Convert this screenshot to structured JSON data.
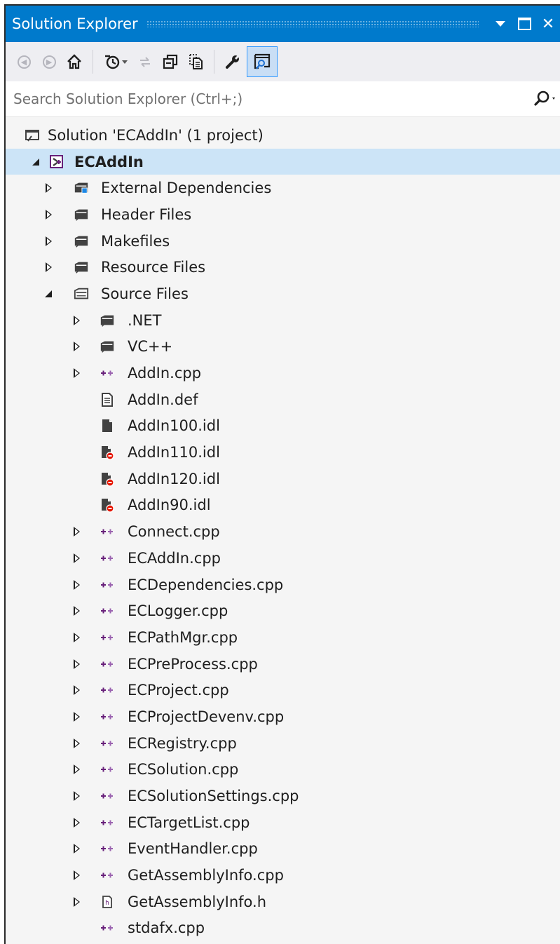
{
  "window": {
    "title": "Solution Explorer",
    "menu_arrow_icon": "dropdown-triangle",
    "maximize_icon": "maximize-square",
    "close_glyph": "✕"
  },
  "toolbar": {
    "buttons": [
      {
        "name": "back-button",
        "icon": "back-arrow-icon"
      },
      {
        "name": "forward-button",
        "icon": "forward-arrow-icon"
      },
      {
        "name": "home-button",
        "icon": "home-icon"
      },
      {
        "name": "pending-changes-button",
        "icon": "clock-history-icon"
      },
      {
        "name": "sync-button",
        "icon": "sync-arrows-icon"
      },
      {
        "name": "collapse-all-button",
        "icon": "collapse-all-icon"
      },
      {
        "name": "show-all-files-button",
        "icon": "show-all-files-icon"
      },
      {
        "name": "properties-button",
        "icon": "wrench-icon"
      },
      {
        "name": "preview-button",
        "icon": "preview-selected-icon"
      }
    ],
    "active_accent": "#3399ff"
  },
  "search": {
    "placeholder": "Search Solution Explorer (Ctrl+;)",
    "icon": "search-icon"
  },
  "colors": {
    "titlebar": "#007acc",
    "selection": "#cce4f7",
    "cpp_icon": "#68217a",
    "excluded_badge": "#e51400",
    "folder": "#424242"
  },
  "tree": [
    {
      "label": "Solution 'ECAddIn' (1 project)",
      "level": 0,
      "expander": "none",
      "icon": "solution-icon"
    },
    {
      "label": "ECAddIn",
      "level": 0,
      "expander": "expanded",
      "icon": "project-icon",
      "selected": true,
      "bold": true
    },
    {
      "label": "External Dependencies",
      "level": 1,
      "expander": "collapsed",
      "icon": "external-deps-folder-icon"
    },
    {
      "label": "Header Files",
      "level": 1,
      "expander": "collapsed",
      "icon": "filter-folder-icon"
    },
    {
      "label": "Makefiles",
      "level": 1,
      "expander": "collapsed",
      "icon": "filter-folder-icon"
    },
    {
      "label": "Resource Files",
      "level": 1,
      "expander": "collapsed",
      "icon": "filter-folder-icon"
    },
    {
      "label": "Source Files",
      "level": 1,
      "expander": "expanded",
      "icon": "filter-folder-open-icon"
    },
    {
      "label": ".NET",
      "level": 2,
      "expander": "collapsed",
      "icon": "filter-folder-icon"
    },
    {
      "label": "VC++",
      "level": 2,
      "expander": "collapsed",
      "icon": "filter-folder-icon"
    },
    {
      "label": "AddIn.cpp",
      "level": 2,
      "expander": "collapsed",
      "icon": "cpp-file-icon"
    },
    {
      "label": "AddIn.def",
      "level": 2,
      "expander": "none",
      "icon": "text-file-icon"
    },
    {
      "label": "AddIn100.idl",
      "level": 2,
      "expander": "none",
      "icon": "idl-file-icon"
    },
    {
      "label": "AddIn110.idl",
      "level": 2,
      "expander": "none",
      "icon": "idl-file-excluded-icon"
    },
    {
      "label": "AddIn120.idl",
      "level": 2,
      "expander": "none",
      "icon": "idl-file-excluded-icon"
    },
    {
      "label": "AddIn90.idl",
      "level": 2,
      "expander": "none",
      "icon": "idl-file-excluded-icon"
    },
    {
      "label": "Connect.cpp",
      "level": 2,
      "expander": "collapsed",
      "icon": "cpp-file-icon"
    },
    {
      "label": "ECAddIn.cpp",
      "level": 2,
      "expander": "collapsed",
      "icon": "cpp-file-icon"
    },
    {
      "label": "ECDependencies.cpp",
      "level": 2,
      "expander": "collapsed",
      "icon": "cpp-file-icon"
    },
    {
      "label": "ECLogger.cpp",
      "level": 2,
      "expander": "collapsed",
      "icon": "cpp-file-icon"
    },
    {
      "label": "ECPathMgr.cpp",
      "level": 2,
      "expander": "collapsed",
      "icon": "cpp-file-icon"
    },
    {
      "label": "ECPreProcess.cpp",
      "level": 2,
      "expander": "collapsed",
      "icon": "cpp-file-icon"
    },
    {
      "label": "ECProject.cpp",
      "level": 2,
      "expander": "collapsed",
      "icon": "cpp-file-icon"
    },
    {
      "label": "ECProjectDevenv.cpp",
      "level": 2,
      "expander": "collapsed",
      "icon": "cpp-file-icon"
    },
    {
      "label": "ECRegistry.cpp",
      "level": 2,
      "expander": "collapsed",
      "icon": "cpp-file-icon"
    },
    {
      "label": "ECSolution.cpp",
      "level": 2,
      "expander": "collapsed",
      "icon": "cpp-file-icon"
    },
    {
      "label": "ECSolutionSettings.cpp",
      "level": 2,
      "expander": "collapsed",
      "icon": "cpp-file-icon"
    },
    {
      "label": "ECTargetList.cpp",
      "level": 2,
      "expander": "collapsed",
      "icon": "cpp-file-icon"
    },
    {
      "label": "EventHandler.cpp",
      "level": 2,
      "expander": "collapsed",
      "icon": "cpp-file-icon"
    },
    {
      "label": "GetAssemblyInfo.cpp",
      "level": 2,
      "expander": "collapsed",
      "icon": "cpp-file-icon"
    },
    {
      "label": "GetAssemblyInfo.h",
      "level": 2,
      "expander": "collapsed",
      "icon": "header-file-icon"
    },
    {
      "label": "stdafx.cpp",
      "level": 2,
      "expander": "none",
      "icon": "cpp-file-icon"
    }
  ]
}
